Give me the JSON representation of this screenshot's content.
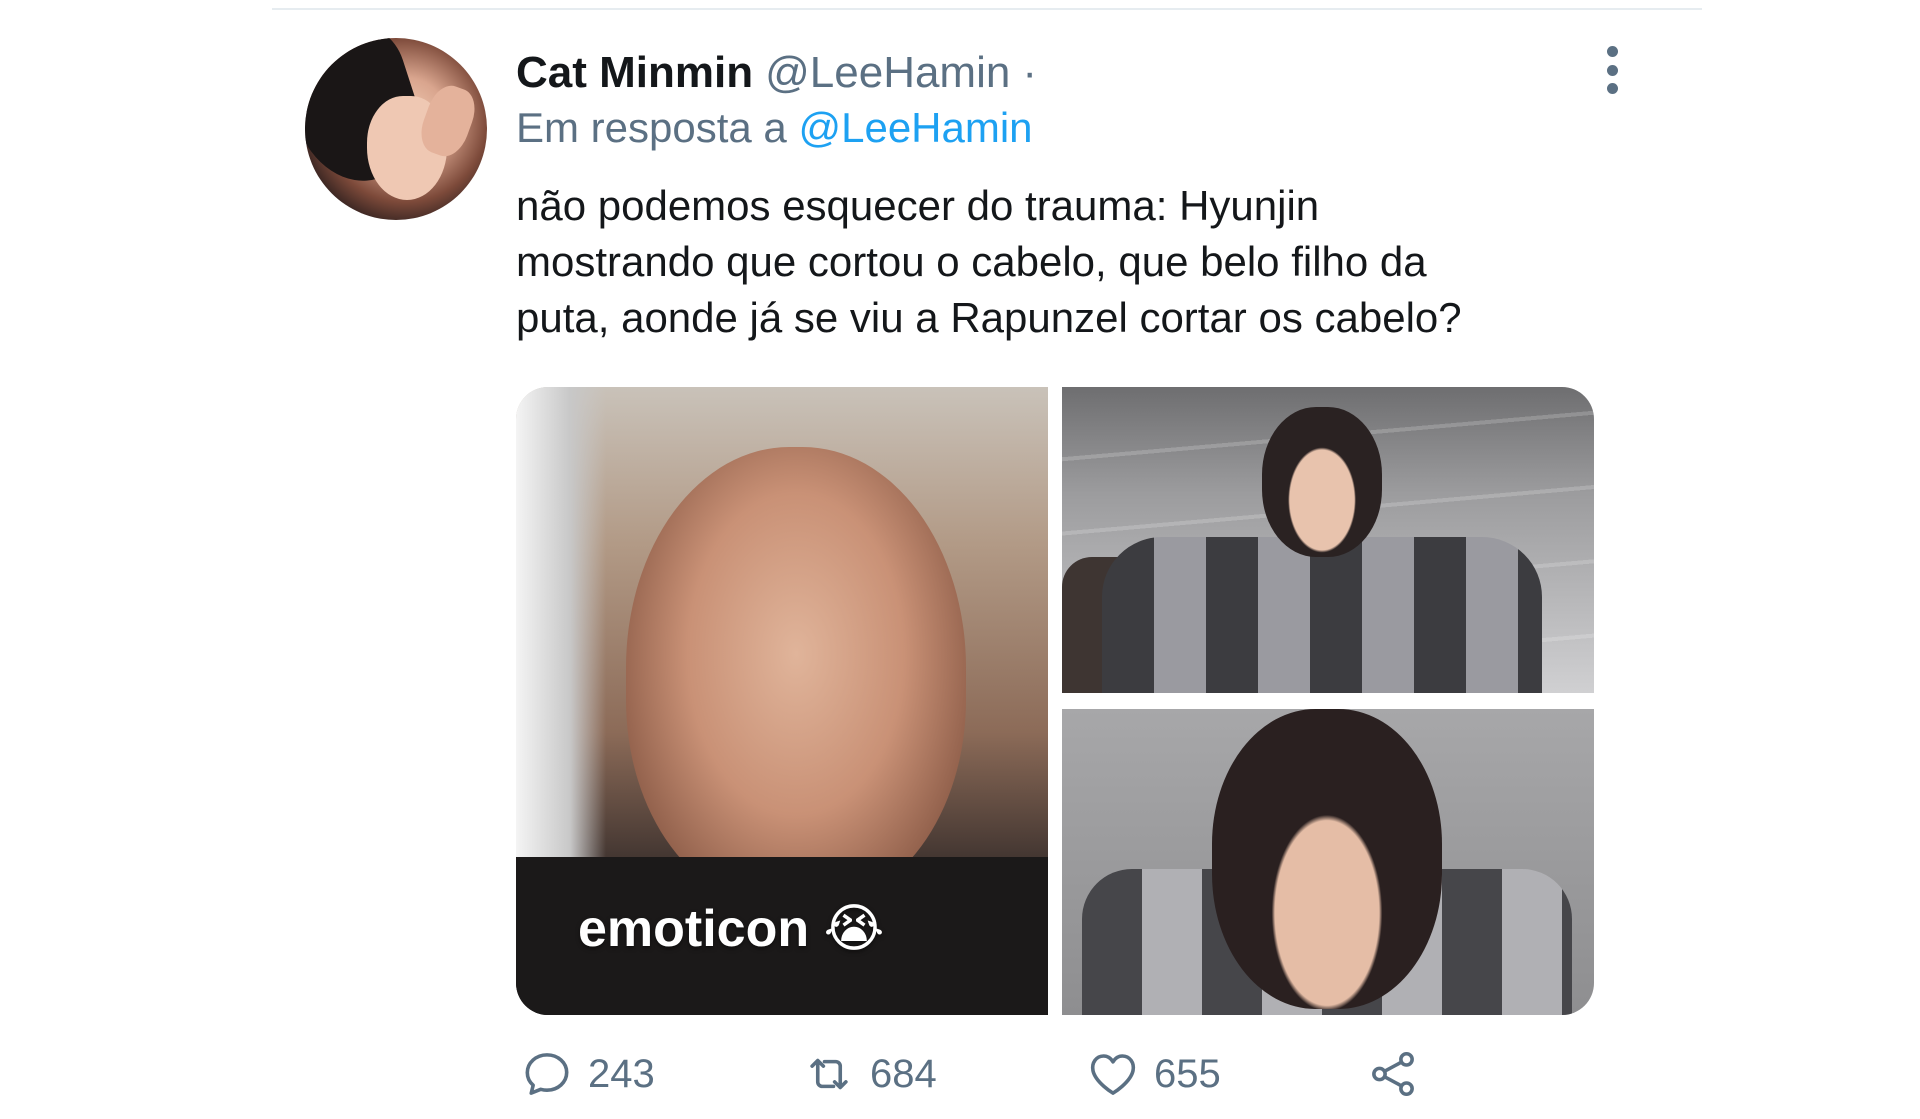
{
  "tweet": {
    "display_name": "Cat Minmin",
    "handle": "@LeeHamin",
    "separator": "·",
    "reply_prefix": "Em resposta a",
    "reply_to": "@LeeHamin",
    "text": "não podemos esquecer do trauma: Hyunjin\nmostrando que cortou o cabelo, que belo filho da\nputa, aonde já se viu a Rapunzel cortar os cabelo?",
    "media_caption": "emoticon 😭",
    "counts": {
      "replies": "243",
      "retweets": "684",
      "likes": "655"
    }
  },
  "icons": {
    "reply": "reply-icon",
    "retweet": "retweet-icon",
    "like": "heart-icon",
    "share": "share-icon",
    "more": "more-vertical-icon"
  },
  "colors": {
    "secondary_text": "#5b7083",
    "link": "#1da1f2",
    "primary_text": "#14171a"
  }
}
